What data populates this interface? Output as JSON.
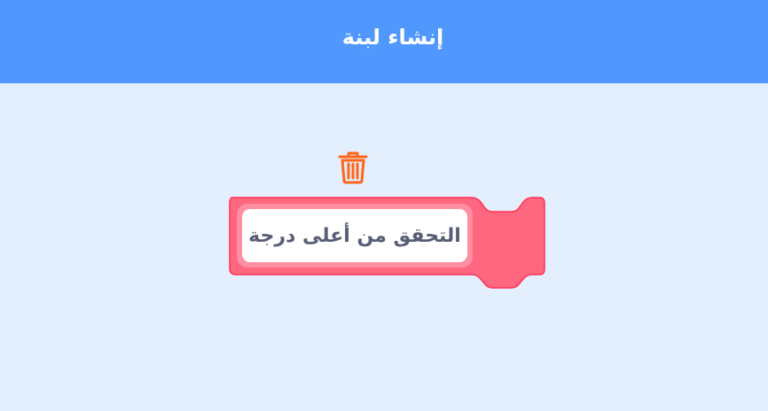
{
  "header": {
    "title": "إنشاء لبنة"
  },
  "colors": {
    "header_bg": "#5098fd",
    "workspace_bg": "#e4effd",
    "block_fill": "#ff6680",
    "block_stroke": "#ff3355",
    "input_border": "#ff8fa0",
    "delete_icon": "#ff661a",
    "text": "#575e75"
  },
  "workspace": {
    "delete_icon": "trash-icon",
    "block": {
      "input_value": "التحقق من أعلى درجة"
    }
  }
}
